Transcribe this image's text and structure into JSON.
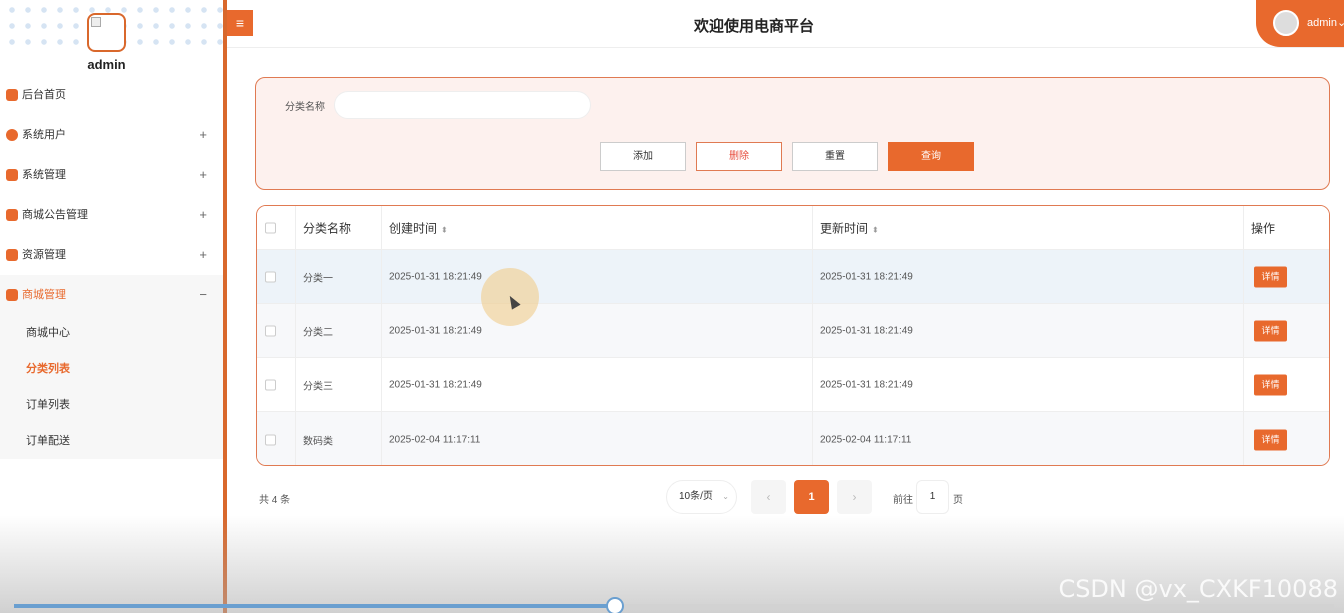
{
  "sidebar": {
    "username": "admin",
    "menu": [
      {
        "label": "后台首页",
        "expand": ""
      },
      {
        "label": "系统用户",
        "expand": "+"
      },
      {
        "label": "系统管理",
        "expand": "+"
      },
      {
        "label": "商城公告管理",
        "expand": "+"
      },
      {
        "label": "资源管理",
        "expand": "+"
      },
      {
        "label": "商城管理",
        "expand": "−"
      }
    ],
    "submenu": [
      "商城中心",
      "分类列表",
      "订单列表",
      "订单配送"
    ]
  },
  "header": {
    "menu_toggle": "≡",
    "title": "欢迎使用电商平台",
    "user": "admin",
    "user_caret": "⌄"
  },
  "search": {
    "label": "分类名称",
    "value": "",
    "buttons": {
      "add": "添加",
      "delete": "删除",
      "reset": "重置",
      "query": "查询"
    }
  },
  "table": {
    "columns": [
      "分类名称",
      "创建时间",
      "更新时间",
      "操作"
    ],
    "sort_icon": "⬍",
    "rows": [
      {
        "name": "分类一",
        "created": "2025-01-31 18:21:49",
        "updated": "2025-01-31 18:21:49",
        "action": "详情"
      },
      {
        "name": "分类二",
        "created": "2025-01-31 18:21:49",
        "updated": "2025-01-31 18:21:49",
        "action": "详情"
      },
      {
        "name": "分类三",
        "created": "2025-01-31 18:21:49",
        "updated": "2025-01-31 18:21:49",
        "action": "详情"
      },
      {
        "name": "数码类",
        "created": "2025-02-04 11:17:11",
        "updated": "2025-02-04 11:17:11",
        "action": "详情"
      }
    ]
  },
  "pagination": {
    "total": "共 4 条",
    "page_size": "10条/页",
    "prev": "‹",
    "current": "1",
    "next": "›",
    "goto_label": "前往",
    "goto_value": "1",
    "page_unit": "页"
  },
  "watermark": "CSDN @vx_CXKF10088",
  "video_progress": 0.455,
  "colors": {
    "accent": "#e8692d",
    "panel_bg": "#fdf1ee",
    "panel_border": "#e07a52"
  }
}
